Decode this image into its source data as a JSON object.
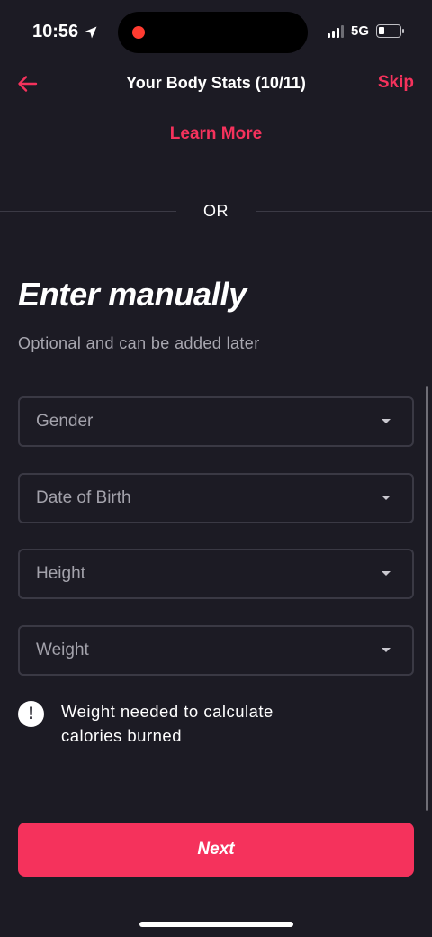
{
  "status_bar": {
    "time": "10:56",
    "network": "5G"
  },
  "header": {
    "title": "Your Body Stats (10/11)",
    "skip_label": "Skip"
  },
  "learn_more_label": "Learn More",
  "divider_label": "OR",
  "section": {
    "title": "Enter manually",
    "subtitle": "Optional and can be added later"
  },
  "fields": [
    {
      "label": "Gender"
    },
    {
      "label": "Date of Birth"
    },
    {
      "label": "Height"
    },
    {
      "label": "Weight"
    }
  ],
  "info": {
    "icon_glyph": "!",
    "text": "Weight needed to calculate calories burned"
  },
  "next_label": "Next",
  "colors": {
    "accent": "#f5325c",
    "background": "#1c1b24",
    "field_border": "#3a3944"
  },
  "icons": [
    "location-arrow-icon",
    "signal-icon",
    "battery-icon",
    "back-arrow-icon",
    "caret-down-icon",
    "info-icon"
  ]
}
